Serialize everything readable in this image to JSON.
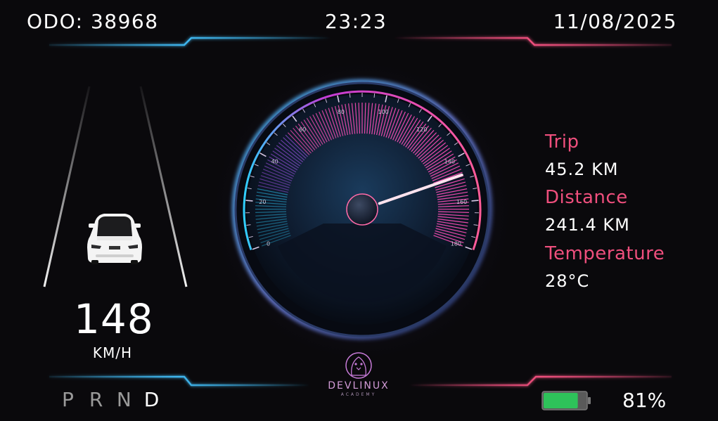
{
  "header": {
    "odometer": "ODO: 38968",
    "time": "23:23",
    "date": "11/08/2025"
  },
  "speed": {
    "value": "148",
    "unit": "KM/H",
    "needle_value": 148,
    "gauge_max": 180,
    "ticks": [
      "0",
      "20",
      "40",
      "60",
      "80",
      "100",
      "120",
      "140",
      "160",
      "180"
    ]
  },
  "gears": {
    "items": [
      "P",
      "R",
      "N",
      "D"
    ],
    "active": "D"
  },
  "info": {
    "trip_label": "Trip",
    "trip_value": "45.2 KM",
    "distance_label": "Distance",
    "distance_value": "241.4 KM",
    "temperature_label": "Temperature",
    "temperature_value": "28°C"
  },
  "battery": {
    "percent_text": "81%",
    "level": 0.81,
    "color": "#2ec25a"
  },
  "logo": {
    "name": "DEVLINUX",
    "sub": "ACADEMY"
  },
  "colors": {
    "accent_blue": "#3fb7f0",
    "accent_pink": "#ef4f7d",
    "background": "#0a090c"
  }
}
